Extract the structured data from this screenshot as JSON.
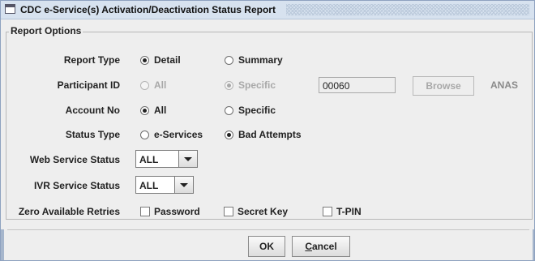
{
  "window": {
    "title": "CDC e-Service(s) Activation/Deactivation Status Report"
  },
  "group": {
    "legend": "Report Options"
  },
  "report_type": {
    "label": "Report Type",
    "options": [
      "Detail",
      "Summary"
    ],
    "selected": "Detail"
  },
  "participant_id": {
    "label": "Participant ID",
    "options": [
      "All",
      "Specific"
    ],
    "selected": "Specific",
    "enabled": false,
    "value": "00060",
    "browse_label": "Browse",
    "code": "ANAS"
  },
  "account_no": {
    "label": "Account No",
    "options": [
      "All",
      "Specific"
    ],
    "selected": "All"
  },
  "status_type": {
    "label": "Status Type",
    "options": [
      "e-Services",
      "Bad Attempts"
    ],
    "selected": "Bad Attempts"
  },
  "web_service_status": {
    "label": "Web Service Status",
    "value": "ALL"
  },
  "ivr_service_status": {
    "label": "IVR Service Status",
    "value": "ALL"
  },
  "zero_retries": {
    "label": "Zero Available Retries",
    "options": [
      "Password",
      "Secret Key",
      "T-PIN"
    ],
    "checked": [
      false,
      false,
      false
    ]
  },
  "buttons": {
    "ok": "OK",
    "cancel_prefix": "C",
    "cancel_rest": "ancel"
  },
  "icons": {
    "window": "window-icon",
    "dropdown": "chevron-down-icon"
  }
}
